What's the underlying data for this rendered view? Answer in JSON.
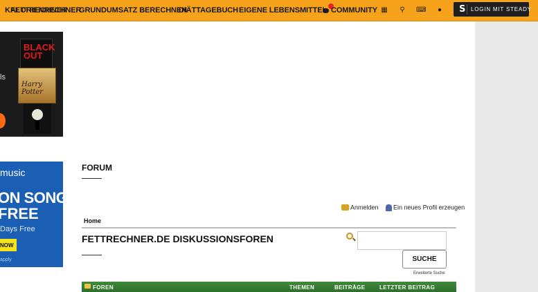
{
  "nav": {
    "brand": "KALORIENRECHNER",
    "brand_overlap": "FETTRECHNER",
    "items": [
      {
        "label": "GRUNDUMSATZ BERECHNEN"
      },
      {
        "label": "DIÄTTAGEBUCH"
      },
      {
        "label": "EIGENE LEBENSMITTEL"
      },
      {
        "label": "COMMUNITY"
      }
    ],
    "icons": [
      "calculator-icon",
      "search-icon",
      "keyboard-icon",
      "user-icon"
    ],
    "login_letter": "S",
    "login_label": "LOGIN MIT STEADY",
    "notification_color": "#e6262b",
    "bar_color": "#f7a21b"
  },
  "ads": {
    "books": {
      "side_text": "ls",
      "book_title": "BLACK OUT",
      "book_title2": "Harry Potter"
    },
    "music": {
      "brand": "music",
      "headline1": "ON SONGS,",
      "headline2": "FREE",
      "days": "Days Free",
      "cta": "NOW",
      "fineprint": "apply"
    }
  },
  "main": {
    "section_title": "FORUM",
    "user_links": {
      "login": "Anmelden",
      "register": "Ein neues Profil erzeugen"
    },
    "breadcrumb": "Home",
    "board_title": "FETTRECHNER.DE DISKUSSIONSFOREN",
    "search": {
      "placeholder": "",
      "button": "SUCHE",
      "advanced": "Erweiterte Suche"
    },
    "table_headers": {
      "forums": "FOREN",
      "topics": "THEMEN",
      "posts": "BEITRÄGE",
      "last_post": "LETZTER BEITRAG"
    },
    "header_color": "#3f8a3a"
  }
}
